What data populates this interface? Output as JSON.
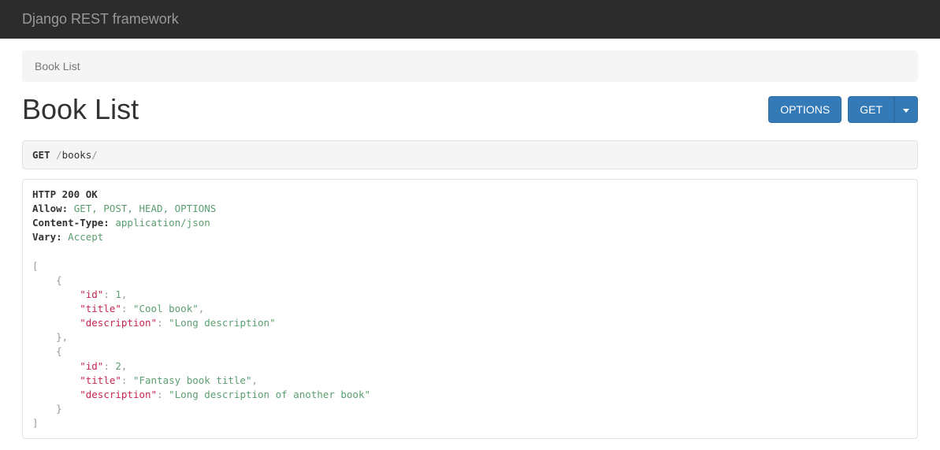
{
  "navbar": {
    "brand": "Django REST framework"
  },
  "breadcrumb": {
    "current": "Book List"
  },
  "page": {
    "title": "Book List"
  },
  "buttons": {
    "options": "OPTIONS",
    "get": "GET"
  },
  "request": {
    "method": "GET",
    "path_segments": [
      "books"
    ]
  },
  "response": {
    "status": "HTTP 200 OK",
    "headers": [
      {
        "name": "Allow:",
        "value": "GET, POST, HEAD, OPTIONS"
      },
      {
        "name": "Content-Type:",
        "value": "application/json"
      },
      {
        "name": "Vary:",
        "value": "Accept"
      }
    ],
    "body": [
      {
        "id": 1,
        "title": "Cool book",
        "description": "Long description"
      },
      {
        "id": 2,
        "title": "Fantasy book title",
        "description": "Long description of another book"
      }
    ]
  }
}
